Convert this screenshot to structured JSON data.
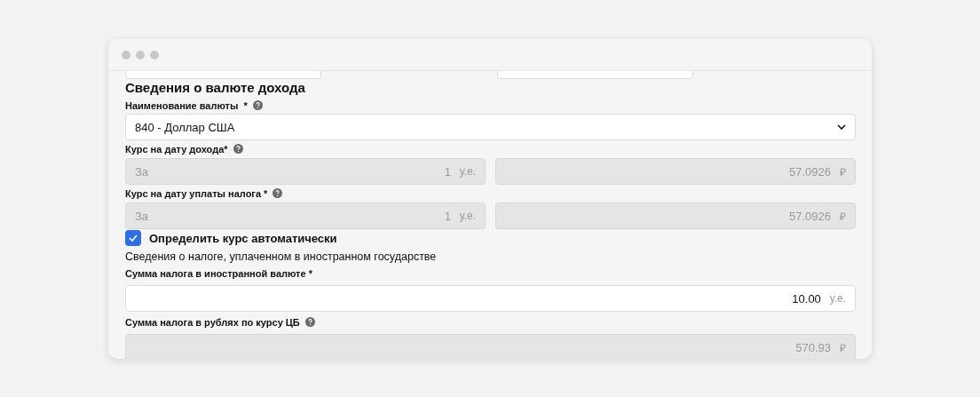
{
  "section_title": "Сведения о валюте дохода",
  "currency": {
    "label": "Наименование валюты  *",
    "help": true,
    "value": "840 - Доллар США"
  },
  "rates": [
    {
      "label": "Курс на дату дохода*",
      "help": true,
      "prefix": "За",
      "amount": "1",
      "unit": "у.е.",
      "value": "57.0926",
      "currency": "₽",
      "disabled": true
    },
    {
      "label": "Курс на дату уплаты налога *",
      "help": true,
      "prefix": "За",
      "amount": "1",
      "unit": "у.е.",
      "value": "57.0926",
      "currency": "₽",
      "disabled": true
    }
  ],
  "auto_rate": {
    "label": "Определить курс автоматически",
    "checked": true
  },
  "tax_section_title": "Сведения о налоге, уплаченном в иностранном государстве",
  "tax_fields": [
    {
      "label": "Сумма налога в иностранной валюте *",
      "help": false,
      "value": "10.00",
      "unit": "у.е.",
      "disabled": false
    },
    {
      "label": "Сумма налога в рублях по курсу ЦБ",
      "help": true,
      "value": "570.93",
      "unit": "₽",
      "disabled": true
    }
  ]
}
